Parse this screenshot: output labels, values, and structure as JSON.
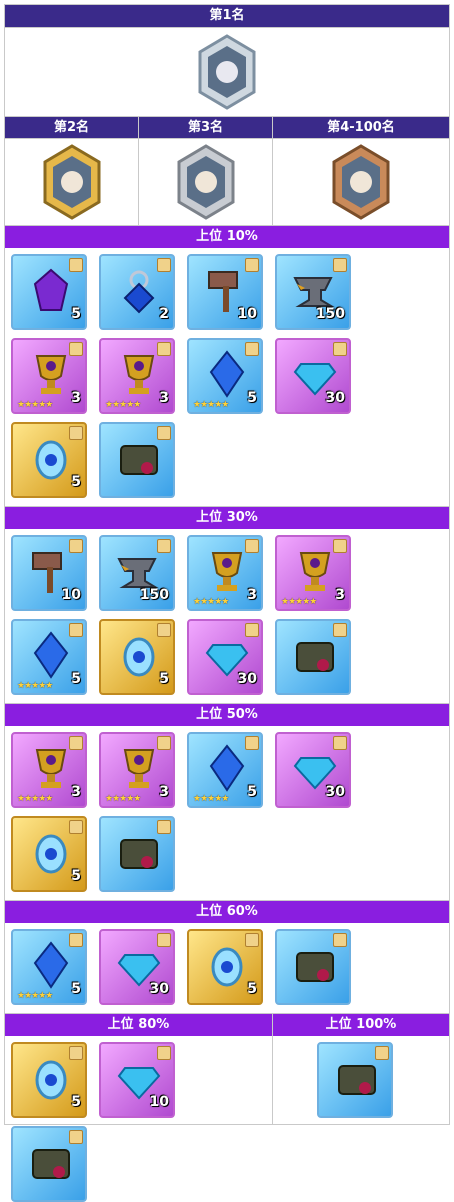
{
  "rank1": {
    "label": "第1名"
  },
  "ranks": [
    {
      "label": "第2名",
      "tier": "gold"
    },
    {
      "label": "第3名",
      "tier": "silver"
    },
    {
      "label": "第4-100名",
      "tier": "bronze"
    }
  ],
  "tiers": [
    {
      "label": "上位 10%",
      "items": [
        {
          "name": "purple-gem",
          "qty": "5",
          "bg": "blue"
        },
        {
          "name": "blue-pendant",
          "qty": "2",
          "bg": "blue"
        },
        {
          "name": "hammer",
          "qty": "10",
          "bg": "blue"
        },
        {
          "name": "anvil",
          "qty": "150",
          "bg": "blue"
        },
        {
          "name": "gold-trophy",
          "qty": "3",
          "bg": "pink",
          "stars": "★★★★★"
        },
        {
          "name": "gold-trophy",
          "qty": "3",
          "bg": "pink",
          "stars": "★★★★★"
        },
        {
          "name": "blue-crystal",
          "qty": "5",
          "bg": "blue",
          "stars": "★★★★★"
        },
        {
          "name": "blue-diamond",
          "qty": "30",
          "bg": "pink"
        },
        {
          "name": "sr-pendant",
          "qty": "5",
          "bg": "gold"
        },
        {
          "name": "chest",
          "qty": "",
          "bg": "blue"
        }
      ]
    },
    {
      "label": "上位 30%",
      "items": [
        {
          "name": "hammer",
          "qty": "10",
          "bg": "blue"
        },
        {
          "name": "anvil",
          "qty": "150",
          "bg": "blue"
        },
        {
          "name": "gold-trophy",
          "qty": "3",
          "bg": "blue",
          "stars": "★★★★★"
        },
        {
          "name": "gold-trophy",
          "qty": "3",
          "bg": "pink",
          "stars": "★★★★★"
        },
        {
          "name": "blue-crystal",
          "qty": "5",
          "bg": "blue",
          "stars": "★★★★★"
        },
        {
          "name": "sr-pendant",
          "qty": "5",
          "bg": "gold"
        },
        {
          "name": "blue-diamond",
          "qty": "30",
          "bg": "pink"
        },
        {
          "name": "chest",
          "qty": "",
          "bg": "blue"
        }
      ]
    },
    {
      "label": "上位 50%",
      "items": [
        {
          "name": "gold-trophy",
          "qty": "3",
          "bg": "pink",
          "stars": "★★★★★"
        },
        {
          "name": "gold-trophy",
          "qty": "3",
          "bg": "pink",
          "stars": "★★★★★"
        },
        {
          "name": "blue-crystal",
          "qty": "5",
          "bg": "blue",
          "stars": "★★★★★"
        },
        {
          "name": "blue-diamond",
          "qty": "30",
          "bg": "pink"
        },
        {
          "name": "sr-pendant",
          "qty": "5",
          "bg": "gold"
        },
        {
          "name": "chest",
          "qty": "",
          "bg": "blue"
        }
      ]
    },
    {
      "label": "上位 60%",
      "items": [
        {
          "name": "blue-crystal",
          "qty": "5",
          "bg": "blue",
          "stars": "★★★★★"
        },
        {
          "name": "blue-diamond",
          "qty": "30",
          "bg": "pink"
        },
        {
          "name": "sr-pendant",
          "qty": "5",
          "bg": "gold"
        },
        {
          "name": "chest",
          "qty": "",
          "bg": "blue"
        }
      ]
    }
  ],
  "bottom": [
    {
      "label": "上位 80%",
      "items": [
        {
          "name": "sr-pendant",
          "qty": "5",
          "bg": "gold"
        },
        {
          "name": "blue-diamond",
          "qty": "10",
          "bg": "pink"
        },
        {
          "name": "chest",
          "qty": "",
          "bg": "blue"
        }
      ]
    },
    {
      "label": "上位 100%",
      "items": [
        {
          "name": "chest",
          "qty": "",
          "bg": "blue"
        }
      ]
    }
  ]
}
